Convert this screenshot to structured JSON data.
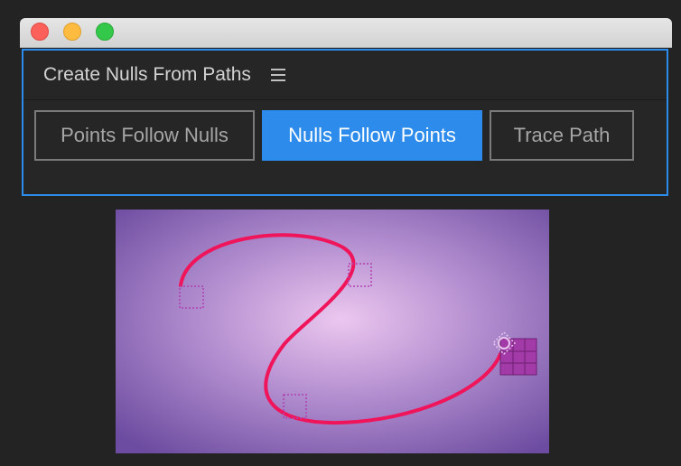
{
  "panel": {
    "title": "Create Nulls From Paths",
    "menu_icon": "hamburger-menu-icon"
  },
  "buttons": {
    "points_follow_nulls": "Points Follow Nulls",
    "nulls_follow_points": "Nulls Follow Points",
    "trace_path": "Trace Path"
  },
  "preview": {
    "path_color": "#f0145a",
    "background_center": "#ebc7ef",
    "background_edge": "#6c4ca0",
    "null_marker_color": "#b040b0"
  },
  "colors": {
    "accent": "#2d8ceb",
    "panel_bg": "#262626"
  }
}
